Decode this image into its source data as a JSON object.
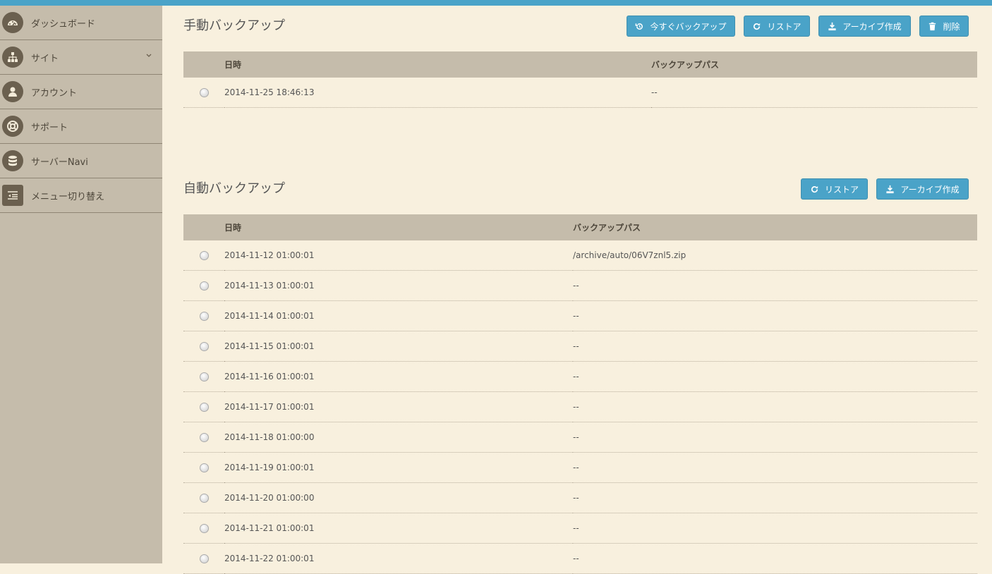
{
  "sidebar": {
    "items": [
      {
        "label": "ダッシュボード",
        "icon": "dashboard-icon"
      },
      {
        "label": "サイト",
        "icon": "sitemap-icon"
      },
      {
        "label": "アカウント",
        "icon": "user-icon"
      },
      {
        "label": "サポート",
        "icon": "lifebuoy-icon"
      },
      {
        "label": "サーバーNavi",
        "icon": "database-icon"
      },
      {
        "label": "メニュー切り替え",
        "icon": "menu-toggle-icon"
      }
    ]
  },
  "manual": {
    "title": "手動バックアップ",
    "buttons": {
      "backup_now": "今すぐバックアップ",
      "restore": "リストア",
      "archive": "アーカイブ作成",
      "delete": "削除"
    },
    "columns": [
      "日時",
      "バックアップパス"
    ],
    "rows": [
      {
        "datetime": "2014-11-25 18:46:13",
        "path": "--"
      }
    ]
  },
  "auto": {
    "title": "自動バックアップ",
    "buttons": {
      "restore": "リストア",
      "archive": "アーカイブ作成"
    },
    "columns": [
      "日時",
      "バックアップパス"
    ],
    "rows": [
      {
        "datetime": "2014-11-12 01:00:01",
        "path": "/archive/auto/06V7znl5.zip"
      },
      {
        "datetime": "2014-11-13 01:00:01",
        "path": "--"
      },
      {
        "datetime": "2014-11-14 01:00:01",
        "path": "--"
      },
      {
        "datetime": "2014-11-15 01:00:01",
        "path": "--"
      },
      {
        "datetime": "2014-11-16 01:00:01",
        "path": "--"
      },
      {
        "datetime": "2014-11-17 01:00:01",
        "path": "--"
      },
      {
        "datetime": "2014-11-18 01:00:00",
        "path": "--"
      },
      {
        "datetime": "2014-11-19 01:00:01",
        "path": "--"
      },
      {
        "datetime": "2014-11-20 01:00:00",
        "path": "--"
      },
      {
        "datetime": "2014-11-21 01:00:01",
        "path": "--"
      },
      {
        "datetime": "2014-11-22 01:00:01",
        "path": "--"
      }
    ]
  },
  "colors": {
    "accent": "#4aa3c8",
    "background": "#f8f0de",
    "sidebar": "#c5bcab",
    "icon": "#6b604f"
  }
}
